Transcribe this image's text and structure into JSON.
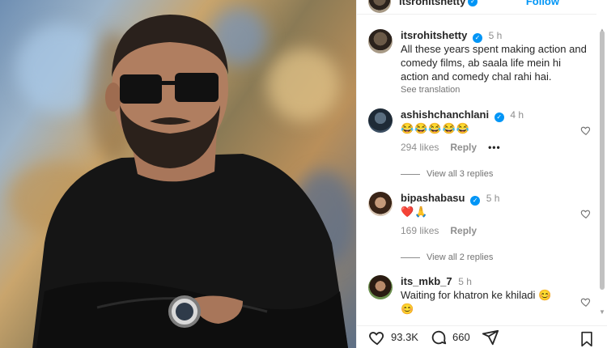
{
  "post": {
    "author": "itsrohitshetty",
    "follow_label": "Follow",
    "caption": {
      "username": "itsrohitshetty",
      "time": "5 h",
      "text": "All these years spent making action and comedy films, ab saala life mein hi action and comedy chal rahi hai.",
      "see_translation": "See translation"
    }
  },
  "comments": [
    {
      "username": "ashishchanchlani",
      "verified": true,
      "time": "4 h",
      "text": "😂😂😂😂😂",
      "likes": "294 likes",
      "reply_label": "Reply",
      "more_label": "•••",
      "view_replies": "View all 3 replies"
    },
    {
      "username": "bipashabasu",
      "verified": true,
      "time": "5 h",
      "text": "❤️🙏",
      "likes": "169 likes",
      "reply_label": "Reply",
      "view_replies": "View all 2 replies"
    },
    {
      "username": "its_mkb_7",
      "verified": false,
      "time": "5 h",
      "text": "Waiting for khatron ke khiladi 😊",
      "text_line2": "😊"
    }
  ],
  "actions": {
    "likes_count": "93.3K",
    "comments_count": "660"
  },
  "colors": {
    "accent": "#0095f6",
    "muted": "#8e8e8e",
    "text": "#262626"
  }
}
